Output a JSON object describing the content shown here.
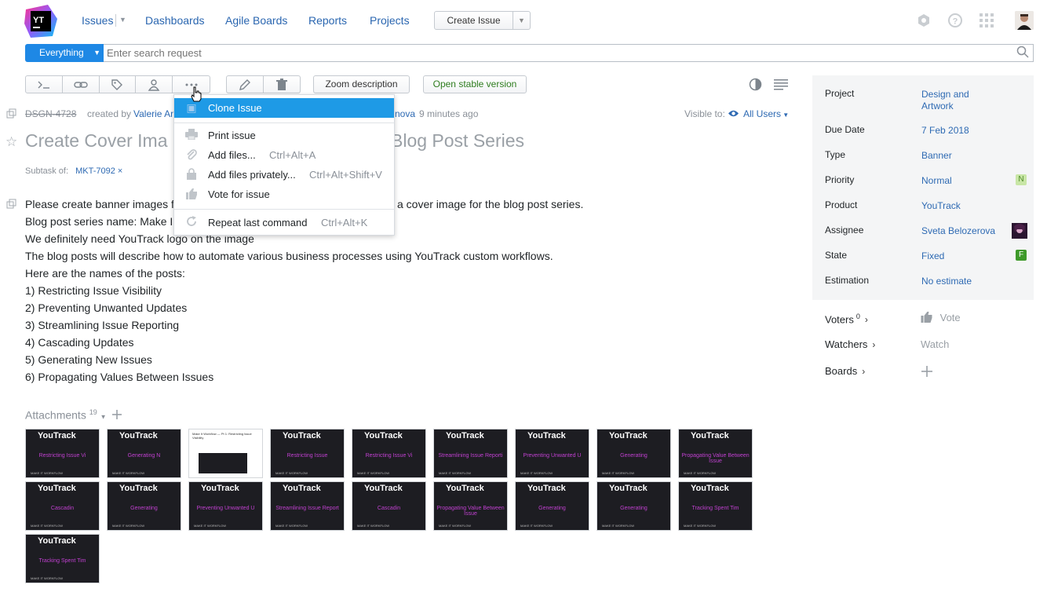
{
  "header": {
    "logo_text": "YT",
    "nav": [
      "Issues",
      "Dashboards",
      "Agile Boards",
      "Reports",
      "Projects"
    ],
    "create_issue": "Create Issue"
  },
  "search": {
    "context": "Everything",
    "placeholder": "Enter search request"
  },
  "toolbar": {
    "zoom": "Zoom description",
    "stable": "Open stable version"
  },
  "issue": {
    "id": "DSGN-4728",
    "created_by_label": "created by",
    "creator": "Valerie An",
    "updater_fragment": "nova",
    "updated_ago": "9 minutes ago",
    "visible_to_label": "Visible to:",
    "visible_to": "All Users",
    "title_left": "Create Cover Ima",
    "title_right": "Blog Post Series",
    "subtask_label": "Subtask of:",
    "subtask_id": "MKT-7092",
    "description": [
      "Please create banner images f",
      "Blog post series name: Make I",
      "We definitely need YouTrack logo on the image",
      "The blog posts will describe how to automate various business processes using YouTrack custom workflows.",
      "Here are the names of the posts:",
      "1) Restricting Issue Visibility",
      "2) Preventing Unwanted Updates",
      "3) Streamlining Issue Reporting",
      "4) Cascading Updates",
      "5) Generating New Issues",
      "6) Propagating Values Between Issues"
    ],
    "description_line1_tail": "a cover image for the blog post series."
  },
  "menu": {
    "items": [
      {
        "label": "Clone Issue",
        "shortcut": ""
      },
      {
        "label": "Print issue",
        "shortcut": ""
      },
      {
        "label": "Add files...",
        "shortcut": "Ctrl+Alt+A"
      },
      {
        "label": "Add files privately...",
        "shortcut": "Ctrl+Alt+Shift+V"
      },
      {
        "label": "Vote for issue",
        "shortcut": ""
      },
      {
        "label": "Repeat last command",
        "shortcut": "Ctrl+Alt+K"
      }
    ]
  },
  "attachments": {
    "label": "Attachments",
    "count": "19",
    "brand": "YouTrack",
    "footer": "MAKE IT WORKFLOW",
    "thumbs": [
      {
        "caption": "Restricting Issue Vi"
      },
      {
        "caption": "Generating N"
      },
      {
        "caption": "Make It Workflow — Pt 1: Restricting Issue Visibility"
      },
      {
        "caption": "Restricting Issue"
      },
      {
        "caption": "Restricting Issue Vi"
      },
      {
        "caption": "Streamlining Issue Reporti"
      },
      {
        "caption": "Preventing Unwanted U"
      },
      {
        "caption": "Generating"
      },
      {
        "caption": "Propagating Value Between Issue"
      },
      {
        "caption": "Cascadin"
      },
      {
        "caption": "Generating"
      },
      {
        "caption": "Preventing Unwanted U"
      },
      {
        "caption": "Streamlining Issue Report"
      },
      {
        "caption": "Cascadin"
      },
      {
        "caption": "Propagating Value Between Issue"
      },
      {
        "caption": "Generating"
      },
      {
        "caption": "Generating"
      },
      {
        "caption": "Tracking Spent Tim"
      },
      {
        "caption": "Tracking Spent Tim"
      }
    ]
  },
  "fields": [
    {
      "label": "Project",
      "value": "Design and Artwork"
    },
    {
      "label": "Due Date",
      "value": "7 Feb 2018"
    },
    {
      "label": "Type",
      "value": "Banner"
    },
    {
      "label": "Priority",
      "value": "Normal",
      "badge": "N"
    },
    {
      "label": "Product",
      "value": "YouTrack"
    },
    {
      "label": "Assignee",
      "value": "Sveta Belozerova"
    },
    {
      "label": "State",
      "value": "Fixed",
      "badge": "F"
    },
    {
      "label": "Estimation",
      "value": "No estimate"
    }
  ],
  "side": {
    "voters": "Voters",
    "voters_count": "0",
    "vote": "Vote",
    "watchers": "Watchers",
    "watch": "Watch",
    "boards": "Boards"
  },
  "colors": {
    "accent": "#1e88e5",
    "menu_active": "#1e9ae6",
    "link": "#2e6ab3",
    "priority_badge": "#c8e6a6",
    "state_badge": "#3e9a2a"
  }
}
